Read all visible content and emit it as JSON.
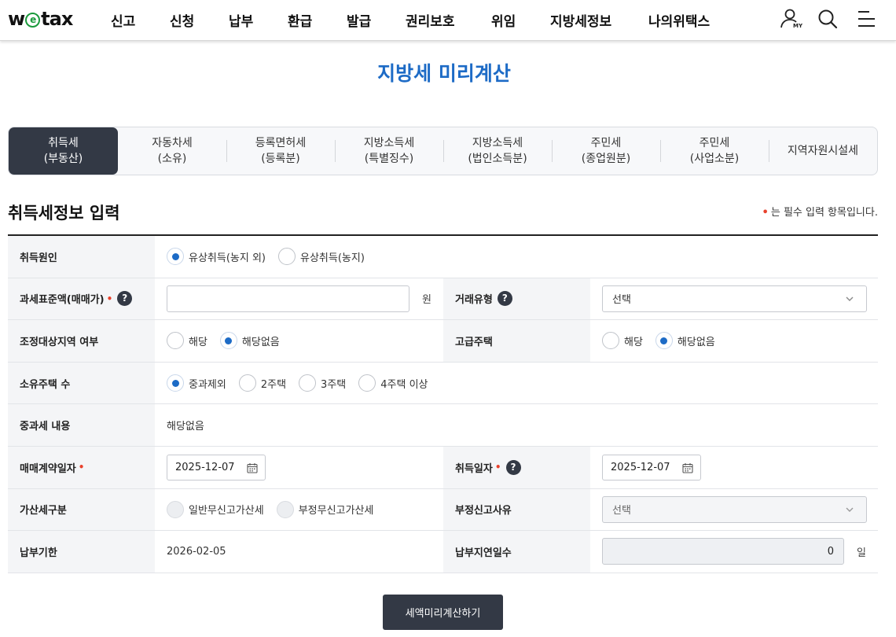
{
  "header": {
    "logo_pre": "w",
    "logo_e": "e",
    "logo_post": "tax",
    "nav": [
      "신고",
      "신청",
      "납부",
      "환급",
      "발급",
      "권리보호",
      "위임",
      "지방세정보",
      "나의위택스"
    ],
    "my_label": "MY",
    "icons": [
      "my-user-icon",
      "search-icon",
      "menu-icon"
    ]
  },
  "page_title": "지방세 미리계산",
  "tabs": [
    {
      "label": "취득세\n(부동산)",
      "active": true
    },
    {
      "label": "자동차세\n(소유)",
      "active": false
    },
    {
      "label": "등록면허세\n(등록분)",
      "active": false
    },
    {
      "label": "지방소득세\n(특별징수)",
      "active": false
    },
    {
      "label": "지방소득세\n(법인소득분)",
      "active": false
    },
    {
      "label": "주민세\n(종업원분)",
      "active": false
    },
    {
      "label": "주민세\n(사업소분)",
      "active": false
    },
    {
      "label": "지역자원시설세",
      "active": false
    }
  ],
  "section": {
    "title": "취득세정보 입력",
    "required_dot": "•",
    "required_note": "는 필수 입력 항목입니다."
  },
  "form": {
    "acq_reason": {
      "label": "취득원인",
      "options": [
        "유상취득(농지 외)",
        "유상취득(농지)"
      ],
      "selected": 0
    },
    "tax_base": {
      "label": "과세표준액(매매가)",
      "value": "",
      "unit": "원"
    },
    "trade_type": {
      "label": "거래유형",
      "selected": "선택"
    },
    "adjust_area": {
      "label": "조정대상지역 여부",
      "options": [
        "해당",
        "해당없음"
      ],
      "selected": 1
    },
    "luxury_house": {
      "label": "고급주택",
      "options": [
        "해당",
        "해당없음"
      ],
      "selected": 1
    },
    "house_count": {
      "label": "소유주택 수",
      "options": [
        "중과제외",
        "2주택",
        "3주택",
        "4주택 이상"
      ],
      "selected": 0
    },
    "heavy_tax": {
      "label": "중과세 내용",
      "value": "해당없음"
    },
    "contract_date": {
      "label": "매매계약일자",
      "value": "2025-12-07"
    },
    "acq_date": {
      "label": "취득일자",
      "value": "2025-12-07"
    },
    "penalty_type": {
      "label": "가산세구분",
      "options": [
        "일반무신고가산세",
        "부정무신고가산세"
      ],
      "selected": null
    },
    "fraud_reason": {
      "label": "부정신고사유",
      "selected": "선택"
    },
    "due_date": {
      "label": "납부기한",
      "value": "2026-02-05"
    },
    "delay_days": {
      "label": "납부지연일수",
      "value": "0",
      "unit": "일"
    }
  },
  "help_glyph": "?",
  "submit_label": "세액미리계산하기",
  "colors": {
    "accent": "#1d6bc6",
    "dark": "#333945",
    "required": "#e8412c",
    "logo_e": "#1a9a3c"
  }
}
